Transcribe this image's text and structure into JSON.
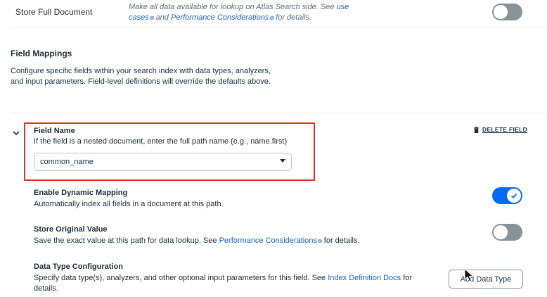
{
  "store_full_document": {
    "label": "Store Full Document",
    "desc_prefix": "Make all data available for lookup on Atlas Search side. See",
    "link1": "use cases",
    "desc_and": "and",
    "link2": "Performance Considerations",
    "desc_suffix": "for details.",
    "enabled": false
  },
  "field_mappings": {
    "title": "Field Mappings",
    "description": "Configure specific fields within your search index with data types, analyzers, and input parameters. Field-level definitions will override the defaults above."
  },
  "field": {
    "name_label": "Field Name",
    "name_help": "If the field is a nested document, enter the full path name (e.g., name.first)",
    "selected_value": "common_name",
    "delete_label": "DELETE FIELD"
  },
  "dynamic_mapping": {
    "title": "Enable Dynamic Mapping",
    "description": "Automatically index all fields in a document at this path.",
    "enabled": true
  },
  "store_original": {
    "title": "Store Original Value",
    "desc_prefix": "Save the exact value at this path for data lookup. See",
    "link": "Performance Considerations",
    "desc_suffix": "for details.",
    "enabled": false
  },
  "data_type_config": {
    "title": "Data Type Configuration",
    "desc_prefix": "Specify data type(s), analyzers, and other optional input parameters for this field. See",
    "link": "Index Definition Docs",
    "desc_suffix": "for details.",
    "button_label": "Add Data Type"
  },
  "colors": {
    "accent": "#016bf8",
    "highlight_border": "#e0341e",
    "link": "#1a5fc7",
    "toggle_off": "#889397"
  },
  "icons": {
    "external_link": "external-link-icon",
    "trash": "trash-icon",
    "chevron": "chevron-down-icon",
    "check": "check-icon",
    "cursor": "mouse-cursor-icon"
  }
}
